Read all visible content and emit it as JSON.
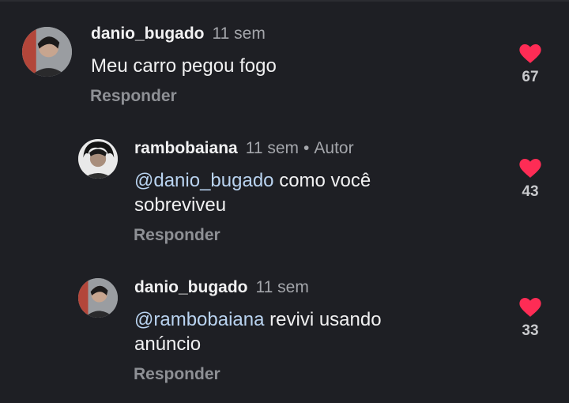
{
  "colors": {
    "background": "#1e1f24",
    "heart": "#fe2c55",
    "mention": "#b9d3f0",
    "muted": "#a4a6ab"
  },
  "comments": [
    {
      "username": "danio_bugado",
      "time": "11 sem",
      "text": "Meu carro pegou fogo",
      "reply_label": "Responder",
      "likes": "67",
      "icon": "heart-icon"
    },
    {
      "username": "rambobaiana",
      "time": "11 sem",
      "separator": "•",
      "badge": "Autor",
      "mention": "@danio_bugado",
      "text_line1": "como você",
      "text_line2": "sobreviveu",
      "reply_label": "Responder",
      "likes": "43",
      "icon": "heart-icon"
    },
    {
      "username": "danio_bugado",
      "time": "11 sem",
      "mention": "@rambobaiana",
      "text_line1": "revivi usando",
      "text_line2": "anúncio",
      "reply_label": "Responder",
      "likes": "33",
      "icon": "heart-icon"
    }
  ]
}
